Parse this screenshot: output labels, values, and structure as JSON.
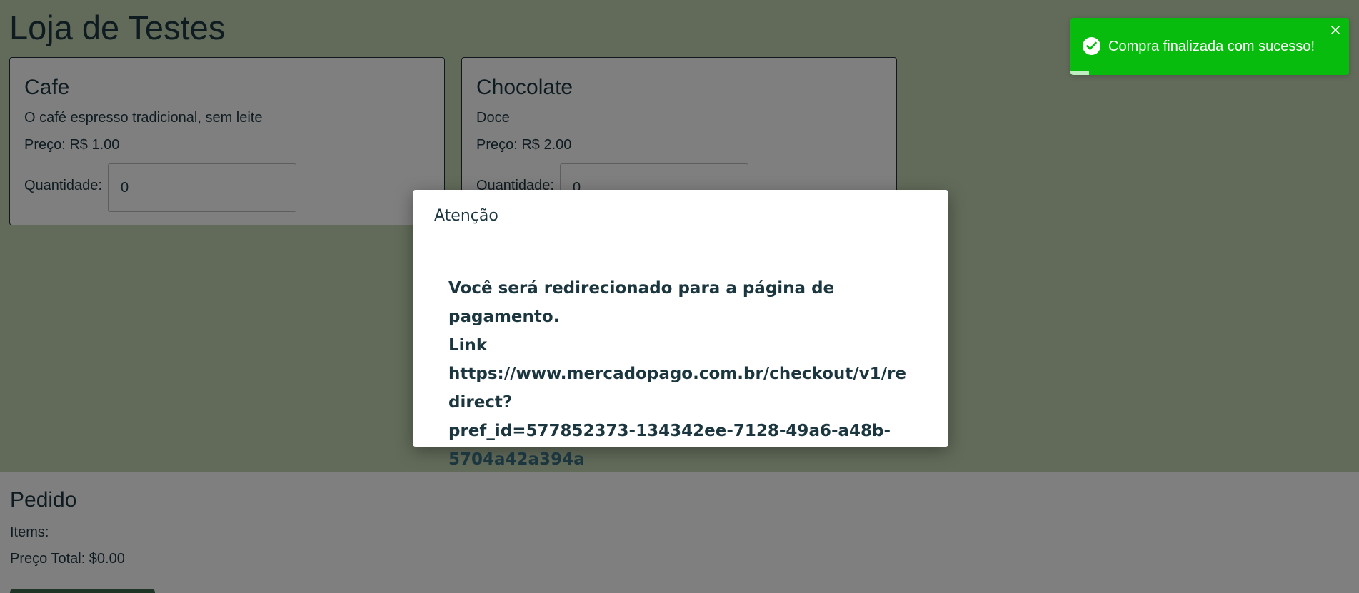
{
  "page": {
    "title": "Loja de Testes"
  },
  "products": [
    {
      "name": "Cafe",
      "description": "O café espresso tradicional, sem leite",
      "price": "Preço: R$ 1.00",
      "quantity_label": "Quantidade:",
      "quantity_value": "0"
    },
    {
      "name": "Chocolate",
      "description": "Doce",
      "price": "Preço: R$ 2.00",
      "quantity_label": "Quantidade:",
      "quantity_value": "0"
    }
  ],
  "order": {
    "title": "Pedido",
    "items_label": "Items:",
    "total_label": "Preço Total: $0.00"
  },
  "modal": {
    "title": "Atenção",
    "line1": "Você será redirecionado para a página de pagamento.",
    "line2": "Link",
    "line3": "https://www.mercadopago.com.br/checkout/v1/redirect?",
    "line4": "pref_id=577852373-134342ee-7128-49a6-a48b-",
    "line5": "5704a42a394a"
  },
  "toast": {
    "message": "Compra finalizada com sucesso!",
    "icon": "check-circle-icon",
    "close_icon": "close-icon",
    "color": "#07bc0c"
  },
  "colors": {
    "page_bg": "#c5d6b4",
    "text": "#1c3640",
    "button": "#3d6a4b"
  }
}
